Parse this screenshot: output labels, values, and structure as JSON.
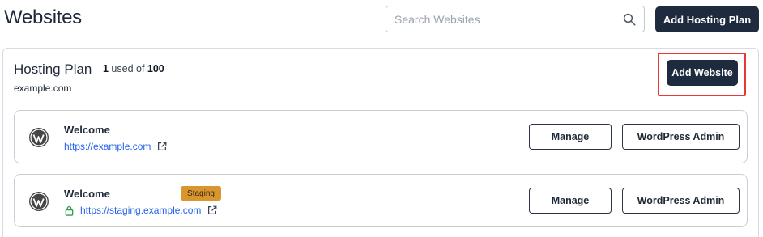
{
  "header": {
    "title": "Websites",
    "search_placeholder": "Search Websites",
    "add_hosting_plan_label": "Add Hosting Plan"
  },
  "plan": {
    "title": "Hosting Plan",
    "used_count": "1",
    "used_text": " used of ",
    "total": "100",
    "domain": "example.com",
    "add_website_label": "Add Website"
  },
  "sites": [
    {
      "name": "Welcome",
      "url": "https://example.com",
      "manage_label": "Manage",
      "wp_admin_label": "WordPress Admin"
    },
    {
      "name": "Welcome",
      "badge": "Staging",
      "url": "https://staging.example.com",
      "manage_label": "Manage",
      "wp_admin_label": "WordPress Admin"
    }
  ],
  "icons": [
    "search-icon",
    "wordpress-icon",
    "external-link-icon",
    "lock-icon"
  ],
  "colors": {
    "primary_dark": "#1e2a3d",
    "link": "#2563eb",
    "staging_badge": "#d9962f",
    "highlight_border": "#e53935",
    "lock_green": "#2e9e4f"
  }
}
